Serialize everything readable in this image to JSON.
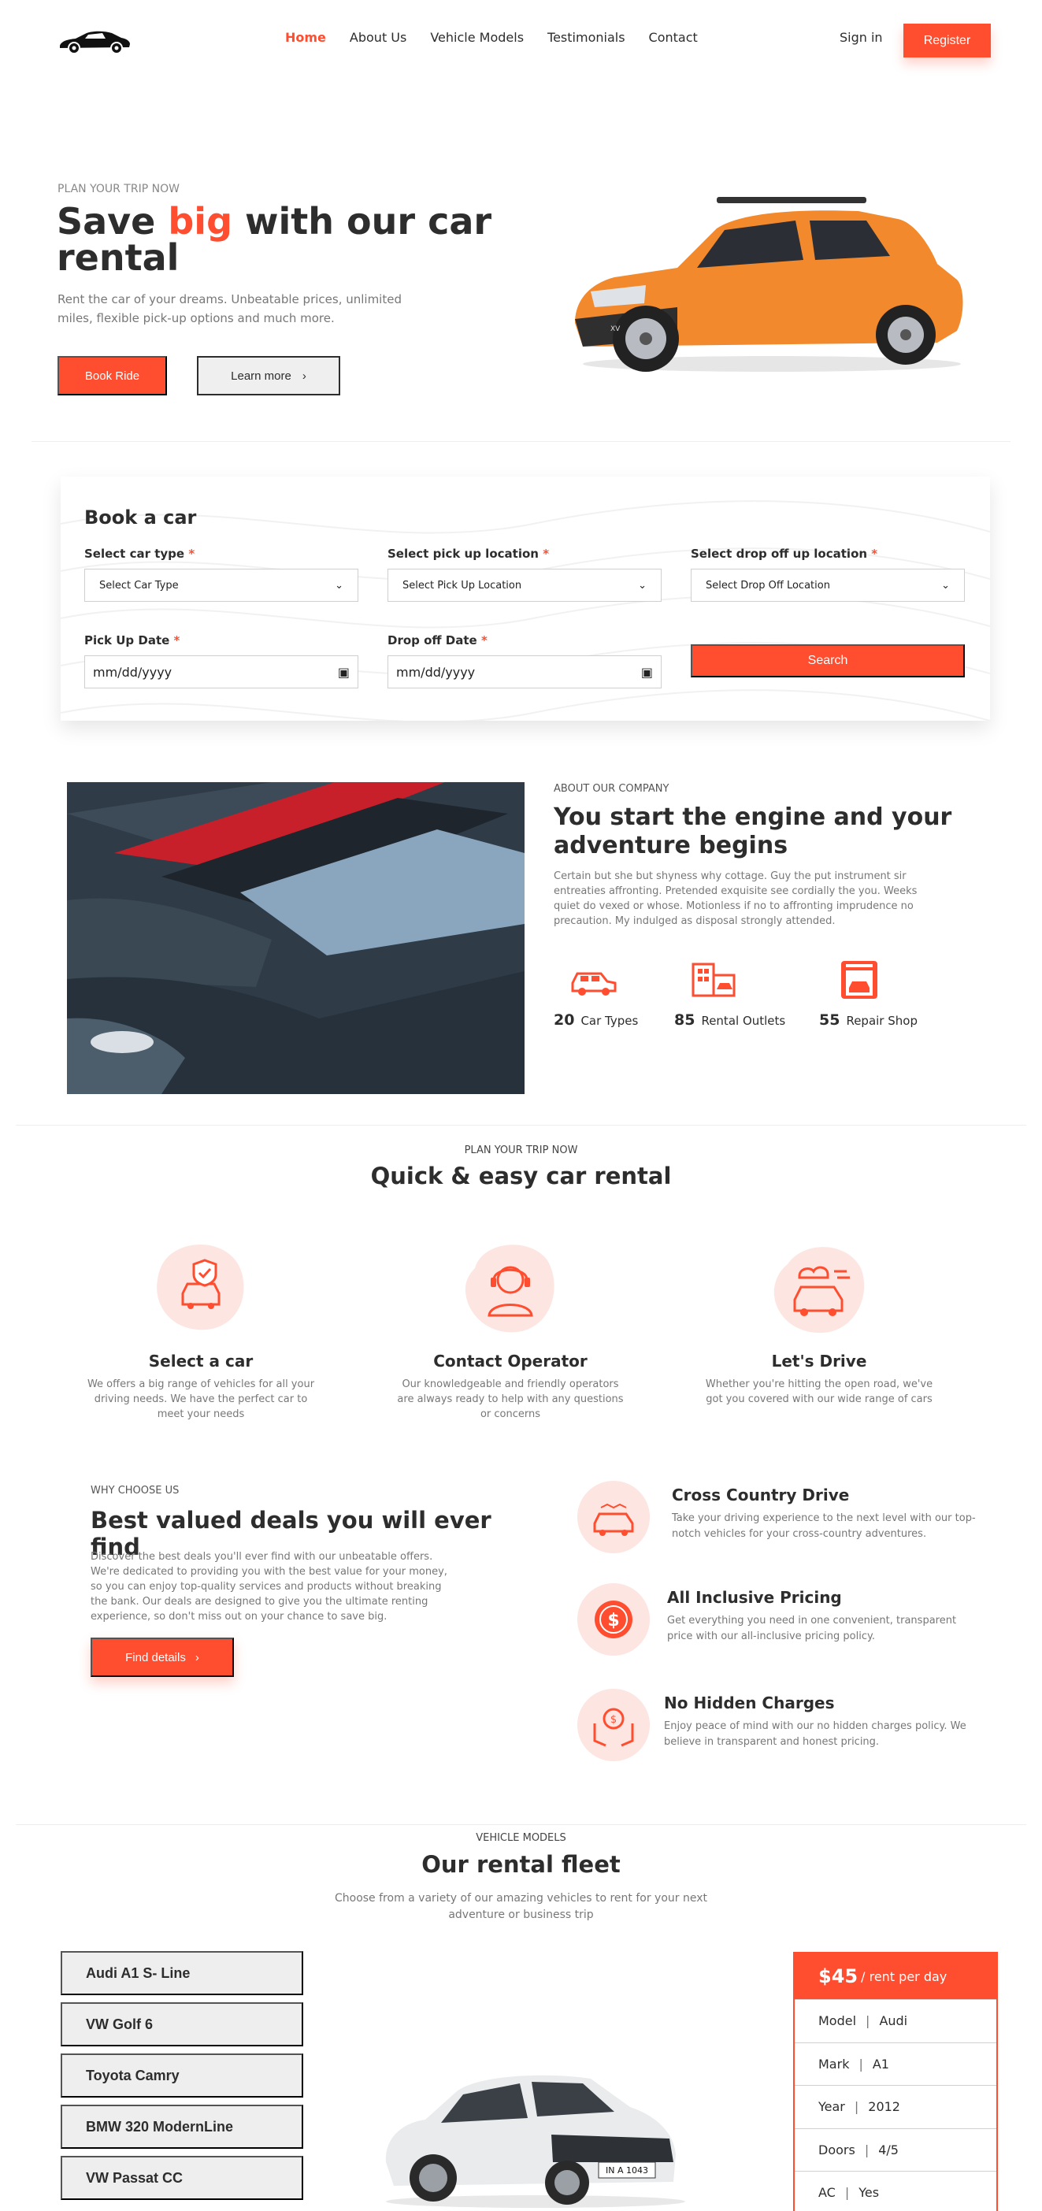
{
  "nav": {
    "links": [
      "Home",
      "About Us",
      "Vehicle Models",
      "Testimonials",
      "Contact"
    ],
    "signin": "Sign in",
    "register": "Register"
  },
  "hero": {
    "eyebrow": "PLAN YOUR TRIP NOW",
    "title_pre": "Save ",
    "title_accent": "big",
    "title_post": " with our car rental",
    "desc": "Rent the car of your dreams. Unbeatable prices, unlimited miles, flexible pick-up options and much more.",
    "book_btn": "Book Ride",
    "learn_btn": "Learn more"
  },
  "book": {
    "title": "Book a car",
    "car_type_label": "Select car type",
    "car_type_value": "Select Car Type",
    "pickup_loc_label": "Select pick up location",
    "pickup_loc_value": "Select Pick Up Location",
    "dropoff_loc_label": "Select drop off up location",
    "dropoff_loc_value": "Select Drop Off Location",
    "pickup_date_label": "Pick Up Date",
    "pickup_date_value": "mm/dd/yyyy",
    "dropoff_date_label": "Drop off Date",
    "dropoff_date_value": "mm/dd/yyyy",
    "required_mark": "*",
    "search_btn": "Search"
  },
  "about": {
    "eyebrow": "ABOUT OUR COMPANY",
    "title": "You start the engine and your adventure begins",
    "desc": "Certain but she but shyness why cottage. Guy the put instrument sir entreaties affronting. Pretended exquisite see cordially the you. Weeks quiet do vexed or whose. Motionless if no to affronting imprudence no precaution. My indulged as disposal strongly attended.",
    "stats": [
      {
        "num": "20",
        "label": "Car Types",
        "icon": "car-types-icon"
      },
      {
        "num": "85",
        "label": "Rental Outlets",
        "icon": "rental-outlets-icon"
      },
      {
        "num": "55",
        "label": "Repair Shop",
        "icon": "repair-shop-icon"
      }
    ]
  },
  "plan": {
    "eyebrow": "PLAN YOUR TRIP NOW",
    "title": "Quick & easy car rental",
    "boxes": [
      {
        "title": "Select a car",
        "desc": "We offers a big range of vehicles for all your driving needs. We have the perfect car to meet your needs"
      },
      {
        "title": "Contact Operator",
        "desc": "Our knowledgeable and friendly operators are always ready to help with any questions or concerns"
      },
      {
        "title": "Let's Drive",
        "desc": "Whether you're hitting the open road, we've got you covered with our wide range of cars"
      }
    ]
  },
  "choose": {
    "eyebrow": "WHY CHOOSE US",
    "title": "Best valued deals you will ever find",
    "desc": "Discover the best deals you'll ever find with our unbeatable offers. We're dedicated to providing you with the best value for your money, so you can enjoy top-quality services and products without breaking the bank. Our deals are designed to give you the ultimate renting experience, so don't miss out on your chance to save big.",
    "btn": "Find details",
    "features": [
      {
        "title": "Cross Country Drive",
        "desc": "Take your driving experience to the next level with our top-notch vehicles for your cross-country adventures."
      },
      {
        "title": "All Inclusive Pricing",
        "desc": "Get everything you need in one convenient, transparent price with our all-inclusive pricing policy."
      },
      {
        "title": "No Hidden Charges",
        "desc": "Enjoy peace of mind with our no hidden charges policy. We believe in transparent and honest pricing."
      }
    ]
  },
  "fleet": {
    "eyebrow": "VEHICLE MODELS",
    "title": "Our rental fleet",
    "desc": "Choose from a variety of our amazing vehicles to rent for your next adventure or business trip",
    "models": [
      "Audi A1 S- Line",
      "VW Golf 6",
      "Toyota Camry",
      "BMW 320 ModernLine",
      "VW Passat CC"
    ],
    "price": "$45",
    "price_unit": "/ rent per day",
    "specs": [
      {
        "key": "Model",
        "value": "Audi"
      },
      {
        "key": "Mark",
        "value": "A1"
      },
      {
        "key": "Year",
        "value": "2012"
      },
      {
        "key": "Doors",
        "value": "4/5"
      },
      {
        "key": "AC",
        "value": "Yes"
      }
    ],
    "plate": "IN A 1043"
  },
  "colors": {
    "accent": "#ff4d30",
    "dark": "#2d2d2d",
    "muted": "#777777"
  }
}
